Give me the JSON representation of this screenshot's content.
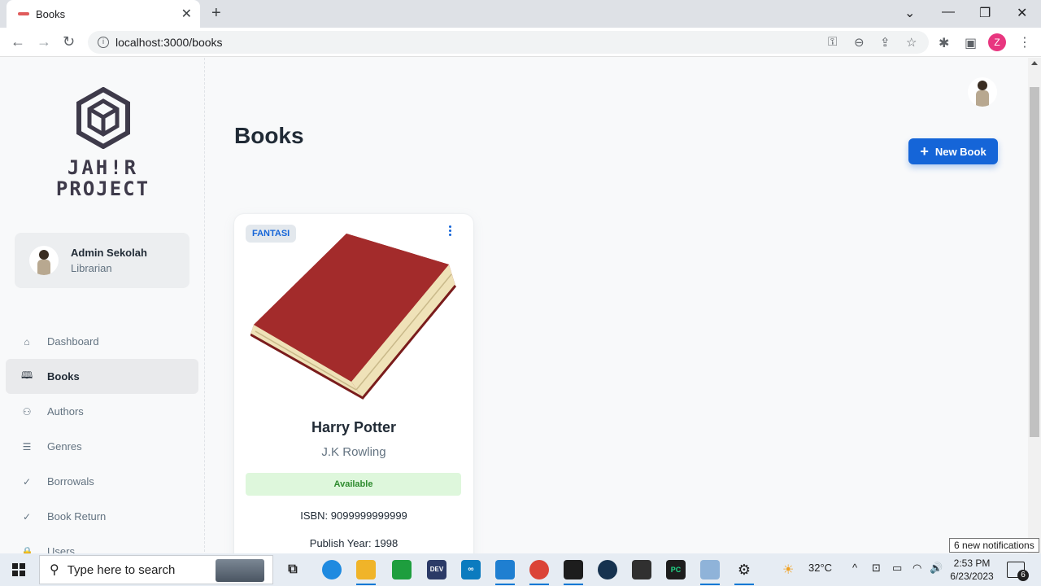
{
  "browser": {
    "tab_title": "Books",
    "url": "localhost:3000/books",
    "profile_initial": "Z"
  },
  "logo": {
    "line1": "JAH!R",
    "line2": "PROJECT"
  },
  "user": {
    "name": "Admin Sekolah",
    "role": "Librarian"
  },
  "nav": {
    "items": [
      {
        "label": "Dashboard",
        "icon": "home-icon"
      },
      {
        "label": "Books",
        "icon": "book-open-icon",
        "active": true
      },
      {
        "label": "Authors",
        "icon": "users-icon"
      },
      {
        "label": "Genres",
        "icon": "list-icon"
      },
      {
        "label": "Borrowals",
        "icon": "check-circle-icon"
      },
      {
        "label": "Book Return",
        "icon": "check-circle-icon"
      },
      {
        "label": "Users",
        "icon": "lock-icon"
      }
    ]
  },
  "page": {
    "title": "Books",
    "new_button": "New Book"
  },
  "books": [
    {
      "genre": "FANTASI",
      "title": "Harry Potter",
      "author": "J.K Rowling",
      "status": "Available",
      "isbn": "ISBN: 9099999999999",
      "publish_year": "Publish Year: 1998"
    }
  ],
  "notifications": {
    "tooltip": "6 new notifications",
    "count": "6"
  },
  "taskbar": {
    "search_placeholder": "Type here to search",
    "weather": "32°C",
    "time": "2:53 PM",
    "date": "6/23/2023"
  },
  "colors": {
    "primary": "#1565d8",
    "available_bg": "#def7dc",
    "available_text": "#2e8b2e"
  }
}
